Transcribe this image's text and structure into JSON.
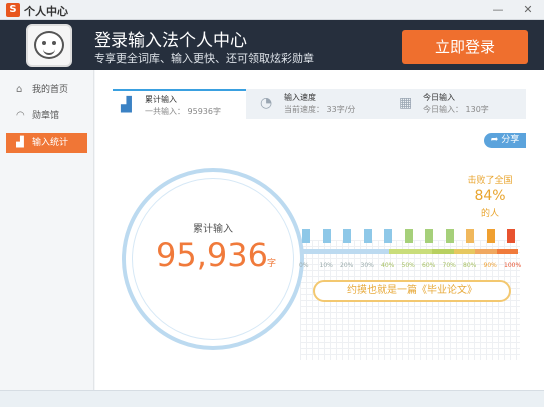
{
  "window": {
    "title": "个人中心",
    "logo_glyph": "S",
    "min_glyph": "—",
    "close_glyph": "✕"
  },
  "banner": {
    "headline": "登录输入法个人中心",
    "subline": "专享更全词库、输入更快、还可领取炫彩勋章",
    "login_label": "立即登录"
  },
  "sidebar": {
    "items": [
      {
        "label": "我的首页",
        "icon": "home-icon",
        "glyph": "⌂"
      },
      {
        "label": "勋章馆",
        "icon": "medal-icon",
        "glyph": "◠"
      },
      {
        "label": "输入统计",
        "icon": "stats-icon",
        "glyph": "▟"
      }
    ]
  },
  "tabs": [
    {
      "title": "累计输入",
      "sub": "一共输入： 95936字",
      "icon": "chart-icon",
      "glyph": "▟"
    },
    {
      "title": "输入速度",
      "sub": "当前速度： 33字/分",
      "icon": "speedometer-icon",
      "glyph": "◔"
    },
    {
      "title": "今日输入",
      "sub": "今日输入： 130字",
      "icon": "calendar-icon",
      "glyph": "▦"
    }
  ],
  "share_label": "分享",
  "total": {
    "label": "累计输入",
    "value": "95,936",
    "unit": "字"
  },
  "beat": {
    "line1": "击败了全国",
    "percent": "84%",
    "line2": "的人",
    "fraction": 0.84
  },
  "scale": [
    "0%",
    "10%",
    "20%",
    "30%",
    "40%",
    "50%",
    "60%",
    "70%",
    "80%",
    "90%",
    "100%"
  ],
  "quote": "约摸也就是一篇《毕业论文》",
  "colors": {
    "accent": "#f07636",
    "people": [
      "#8ec8e8",
      "#8ec8e8",
      "#8ec8e8",
      "#8ec8e8",
      "#8ec8e8",
      "#a6d07a",
      "#a6d07a",
      "#a6d07a",
      "#f0b85c",
      "#f0a030",
      "#e8532f"
    ],
    "bar": [
      "#bcdaf0",
      "#bcdaf0",
      "#bcdaf0",
      "#bcdaf0",
      "#c9dd7a",
      "#c9dd7a",
      "#b8d060",
      "#e6c860",
      "#f0a860",
      "#f07a3b"
    ]
  }
}
